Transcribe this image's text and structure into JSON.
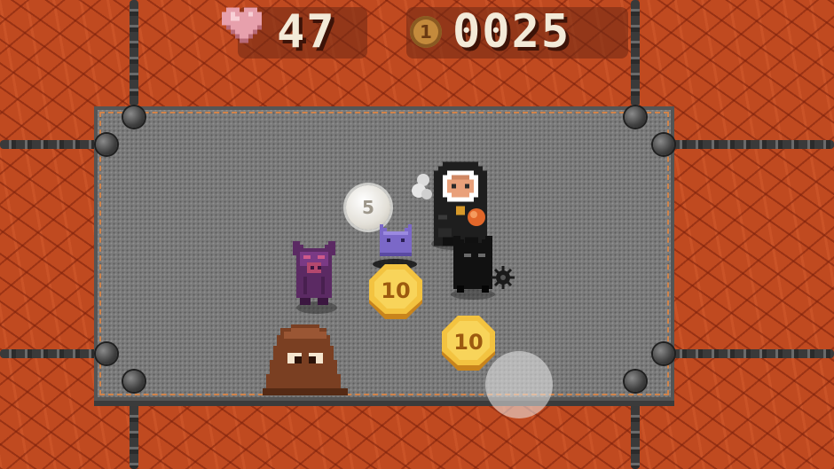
{
  "hud": {
    "health": "47",
    "coins": "0025",
    "health_icon": "heart-icon",
    "coin_icon": "coin-icon",
    "coin_icon_label": "1"
  },
  "pickups": {
    "silver_coin_value": "5",
    "gold_coin_a_value": "10",
    "gold_coin_b_value": "10"
  },
  "colors": {
    "lava": "#c04a20",
    "arena": "#7a7a7a",
    "gold": "#f0b83a",
    "heart": "#e89aa6"
  }
}
